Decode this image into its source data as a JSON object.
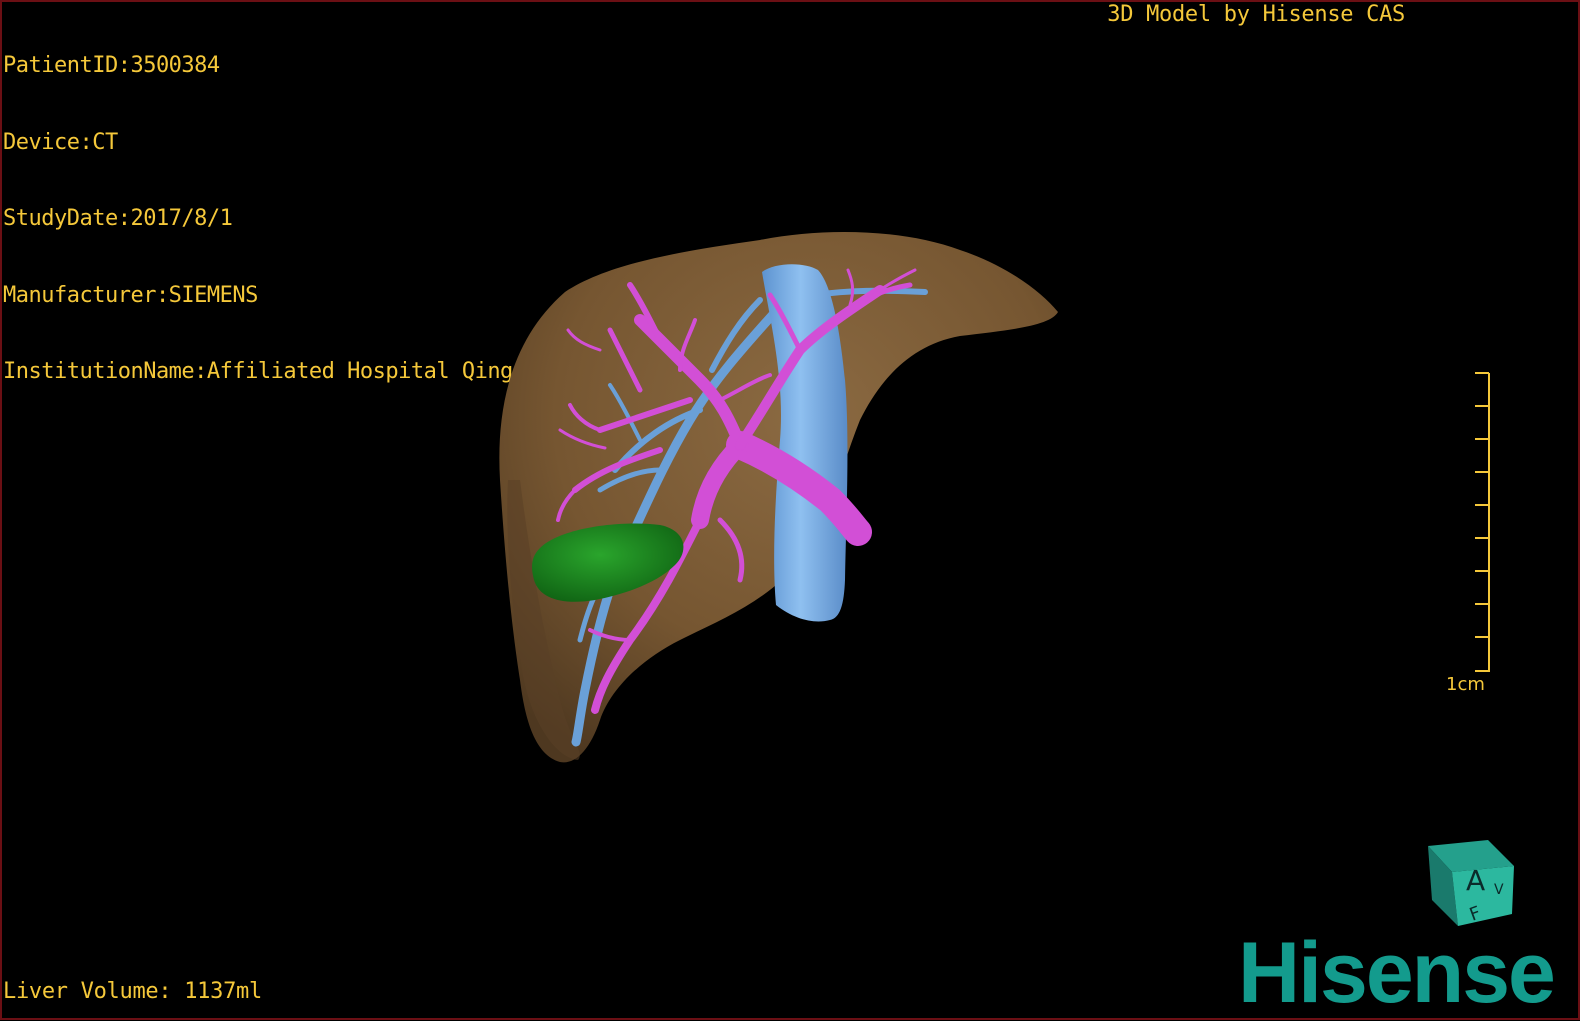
{
  "overlay": {
    "patient_id": "PatientID:3500384",
    "device": "Device:CT",
    "study_date": "StudyDate:2017/8/1",
    "manufacturer": "Manufacturer:SIEMENS",
    "institution": "InstitutionName:Affiliated Hospital Qingdao University-C"
  },
  "credit": "3D Model by Hisense CAS",
  "liver_volume": "Liver Volume: 1137ml",
  "scale_bar": {
    "label": "1cm"
  },
  "orientation_cube": {
    "face_front": "A",
    "face_bottom": "F",
    "face_right": "V"
  },
  "brand": "Hisense",
  "colors": {
    "text": "#f5c83a",
    "liver": "#7a5a36",
    "vena_cava": "#7fb2e8",
    "portal_vein": "#d24fd6",
    "gallbladder": "#1f8a22",
    "brand": "#139b8d",
    "border": "#6b0f14"
  },
  "icons": [
    "orientation-cube-icon",
    "scale-bar-icon"
  ]
}
